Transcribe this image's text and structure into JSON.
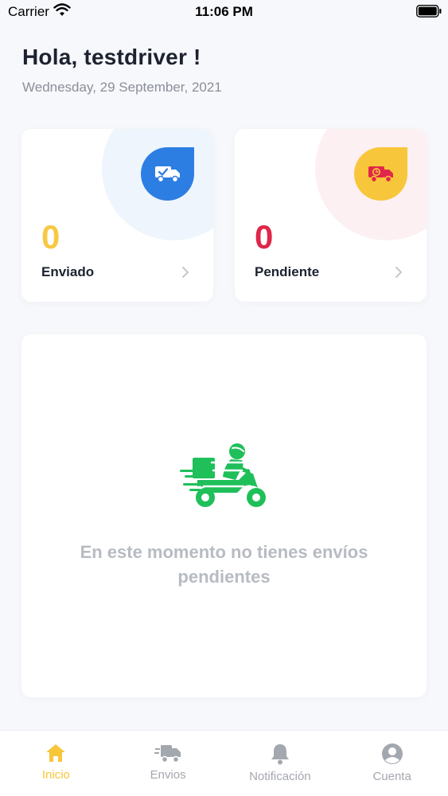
{
  "status_bar": {
    "carrier": "Carrier",
    "time": "11:06 PM"
  },
  "header": {
    "greeting": "Hola, testdriver !",
    "date": "Wednesday, 29 September, 2021"
  },
  "stats": [
    {
      "value": "0",
      "label": "Enviado",
      "icon": "truck-check-icon",
      "accent": "#2d7ee3",
      "value_color": "#f7c943"
    },
    {
      "value": "0",
      "label": "Pendiente",
      "icon": "truck-clock-icon",
      "accent": "#f8c63a",
      "value_color": "#e0264a"
    }
  ],
  "empty_state": {
    "icon": "delivery-scooter-icon",
    "message": "En este momento no tienes envíos pendientes",
    "illustration_color": "#1fbf5a"
  },
  "tabs": [
    {
      "label": "Inicio",
      "icon": "home-icon",
      "active": true
    },
    {
      "label": "Envios",
      "icon": "truck-icon",
      "active": false
    },
    {
      "label": "Notificación",
      "icon": "bell-icon",
      "active": false
    },
    {
      "label": "Cuenta",
      "icon": "account-icon",
      "active": false
    }
  ],
  "colors": {
    "active_tab": "#f8c63a",
    "inactive_tab": "#a3a7ae",
    "background": "#f7f8fb"
  }
}
